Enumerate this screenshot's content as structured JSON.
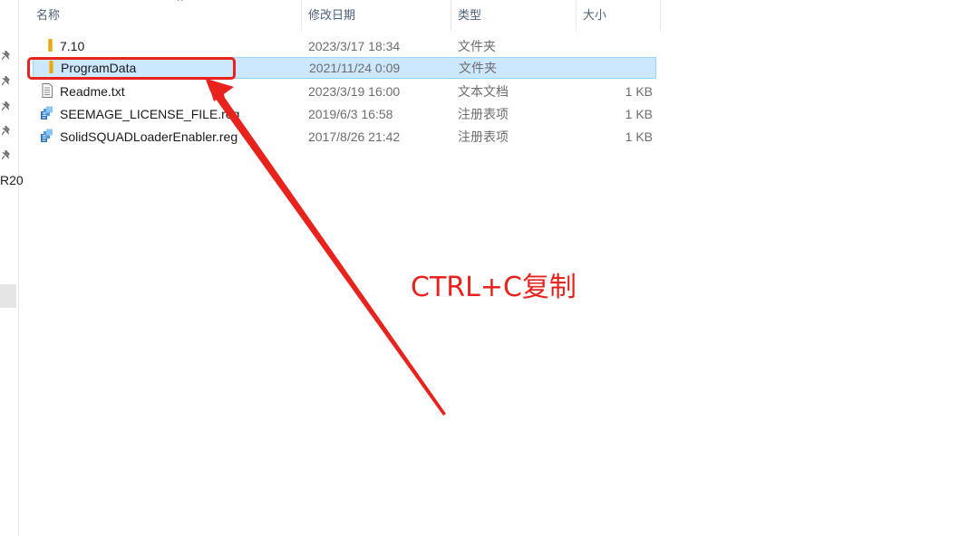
{
  "left_panel": {
    "truncated_text": "R20",
    "pins": [
      {
        "icon": "pin-icon"
      },
      {
        "icon": "pin-icon"
      },
      {
        "icon": "pin-icon"
      },
      {
        "icon": "pin-icon"
      },
      {
        "icon": "pin-icon"
      }
    ]
  },
  "columns": {
    "name": "名称",
    "modified": "修改日期",
    "type": "类型",
    "size": "大小"
  },
  "files": [
    {
      "name": "7.10",
      "modified": "2023/3/17 18:34",
      "type": "文件夹",
      "size": "",
      "icon": "folder-icon"
    },
    {
      "name": "ProgramData",
      "modified": "2021/11/24 0:09",
      "type": "文件夹",
      "size": "",
      "icon": "folder-icon",
      "selected": true
    },
    {
      "name": "Readme.txt",
      "modified": "2023/3/19 16:00",
      "type": "文本文档",
      "size": "1 KB",
      "icon": "text-file-icon"
    },
    {
      "name": "SEEMAGE_LICENSE_FILE.reg",
      "modified": "2019/6/3 16:58",
      "type": "注册表项",
      "size": "1 KB",
      "icon": "registry-file-icon"
    },
    {
      "name": "SolidSQUADLoaderEnabler.reg",
      "modified": "2017/8/26 21:42",
      "type": "注册表项",
      "size": "1 KB",
      "icon": "registry-file-icon"
    }
  ],
  "annotation": {
    "text": "CTRL+C复制",
    "color": "#e8231d"
  },
  "colors": {
    "selection_bg": "#cce8ff",
    "selection_border": "#99d1ff",
    "header_text": "#4c607a",
    "folder": "#f4c247"
  }
}
